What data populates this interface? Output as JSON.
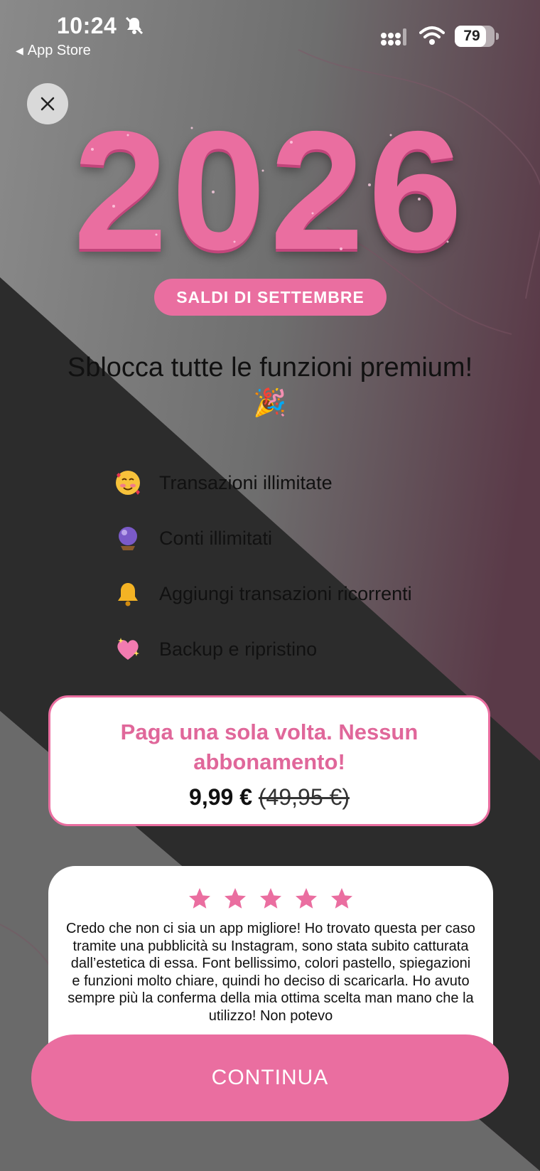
{
  "status_bar": {
    "time": "10:24",
    "back_label": "App Store",
    "battery": "79",
    "battery_level": 0.79
  },
  "year": "2026",
  "sale_badge": "SALDI DI SETTEMBRE",
  "headline": "Sblocca tutte le funzioni premium! 🎉",
  "features": [
    {
      "icon": "smiling-face-with-hearts-icon",
      "label": "Transazioni illimitate"
    },
    {
      "icon": "crystal-ball-icon",
      "label": "Conti illimitati"
    },
    {
      "icon": "bell-icon",
      "label": "Aggiungi transazioni ricorrenti"
    },
    {
      "icon": "sparkling-heart-icon",
      "label": "Backup e ripristino"
    }
  ],
  "price_card": {
    "title": "Paga una sola volta. Nessun abbonamento!",
    "price": "9,99 €",
    "old_price": "(49,95 €)"
  },
  "review": {
    "stars": 5,
    "text": "Credo che non ci sia un app migliore! Ho trovato questa per caso tramite una pubblicità su Instagram, sono stata subito catturata dall’estetica di essa. Font bellissimo, colori pastello, spiegazioni e funzioni molto chiare, quindi ho deciso di scaricarla. Ho avuto sempre più la conferma della mia ottima scelta man mano che la utilizzo! Non potevo"
  },
  "continue_button": "CONTINUA",
  "colors": {
    "accent": "#ea6ea0",
    "dark_band": "#2b2b2b",
    "light_gray": "#6b6b6b"
  }
}
